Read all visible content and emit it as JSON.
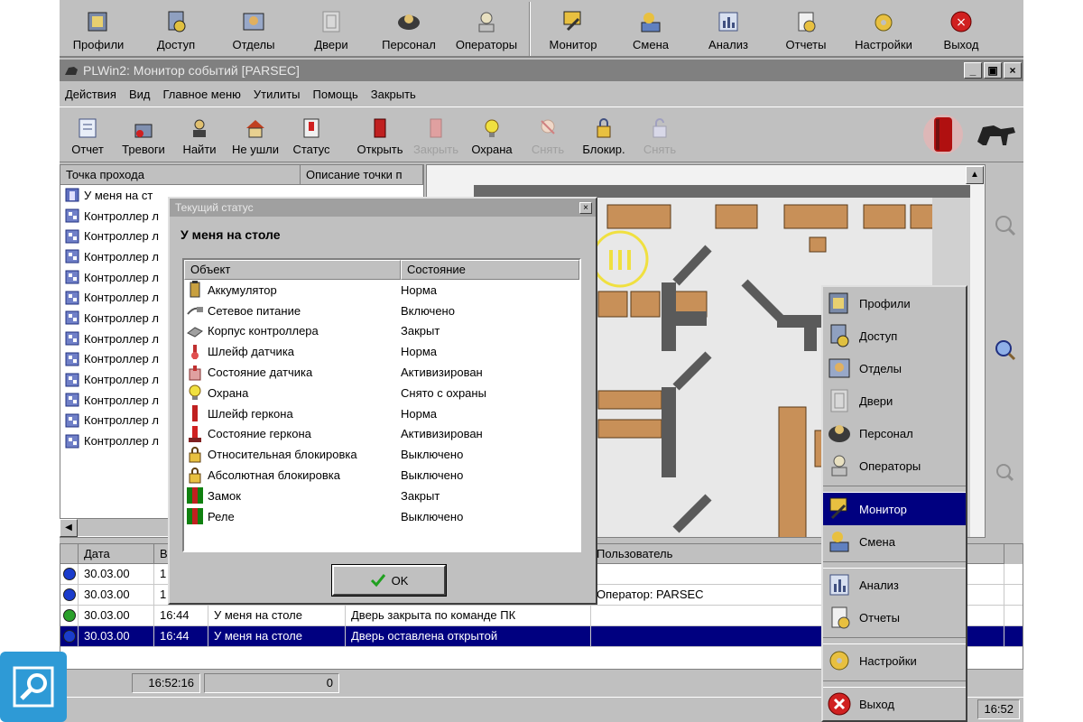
{
  "top_toolbar": [
    {
      "label": "Профили",
      "icon": "profiles-icon"
    },
    {
      "label": "Доступ",
      "icon": "access-icon"
    },
    {
      "label": "Отделы",
      "icon": "departments-icon"
    },
    {
      "label": "Двери",
      "icon": "doors-icon"
    },
    {
      "label": "Персонал",
      "icon": "personnel-icon"
    },
    {
      "label": "Операторы",
      "icon": "operators-icon"
    },
    {
      "label": "Монитор",
      "icon": "monitor-icon"
    },
    {
      "label": "Смена",
      "icon": "shift-icon"
    },
    {
      "label": "Анализ",
      "icon": "analysis-icon"
    },
    {
      "label": "Отчеты",
      "icon": "reports-icon"
    },
    {
      "label": "Настройки",
      "icon": "settings-icon"
    },
    {
      "label": "Выход",
      "icon": "exit-icon"
    }
  ],
  "window": {
    "title": "PLWin2: Монитор событий [PARSEC]",
    "controls": [
      "_",
      "▣",
      "×"
    ]
  },
  "menu": [
    "Действия",
    "Вид",
    "Главное меню",
    "Утилиты",
    "Помощь",
    "Закрыть"
  ],
  "toolbar2": [
    {
      "label": "Отчет",
      "disabled": false
    },
    {
      "label": "Тревоги",
      "disabled": false
    },
    {
      "label": "Найти",
      "disabled": false
    },
    {
      "label": "Не ушли",
      "disabled": false
    },
    {
      "label": "Статус",
      "disabled": false
    },
    {
      "label": "Открыть",
      "disabled": false
    },
    {
      "label": "Закрыть",
      "disabled": true
    },
    {
      "label": "Охрана",
      "disabled": false
    },
    {
      "label": "Снять",
      "disabled": true
    },
    {
      "label": "Блокир.",
      "disabled": false
    },
    {
      "label": "Снять",
      "disabled": true
    }
  ],
  "tree": {
    "columns": [
      "Точка прохода",
      "Описание точки п"
    ],
    "rows": [
      "У меня на ст",
      "Контроллер л",
      "Контроллер л",
      "Контроллер л",
      "Контроллер л",
      "Контроллер л",
      "Контроллер л",
      "Контроллер л",
      "Контроллер л",
      "Контроллер л",
      "Контроллер л",
      "Контроллер л",
      "Контроллер л"
    ]
  },
  "events": {
    "columns": [
      "",
      "Дата",
      "В",
      "",
      "",
      "Пользователь"
    ],
    "rows": [
      {
        "status": "#1a3ccc",
        "date": "30.03.00",
        "time": "1",
        "point": "",
        "event": "",
        "user": "",
        "selected": false
      },
      {
        "status": "#1a3ccc",
        "date": "30.03.00",
        "time": "1",
        "point": "",
        "event": "",
        "user": "Оператор: PARSEC",
        "selected": false
      },
      {
        "status": "#2aa02a",
        "date": "30.03.00",
        "time": "16:44",
        "point": "У меня на столе",
        "event": "Дверь закрыта по команде ПК",
        "user": "",
        "selected": false
      },
      {
        "status": "#1a3ccc",
        "date": "30.03.00",
        "time": "16:44",
        "point": "У меня на столе",
        "event": "Дверь оставлена открытой",
        "user": "",
        "selected": true
      }
    ]
  },
  "statusbar": {
    "time": "16:52:16",
    "count": "0",
    "clock": "16:52"
  },
  "dialog": {
    "title": "Текущий статус",
    "subtitle": "У меня на столе",
    "columns": [
      "Объект",
      "Состояние"
    ],
    "rows": [
      {
        "object": "Аккумулятор",
        "state": "Норма",
        "icon": "battery-icon"
      },
      {
        "object": "Сетевое питание",
        "state": "Включено",
        "icon": "power-plug-icon"
      },
      {
        "object": "Корпус контроллера",
        "state": "Закрыт",
        "icon": "controller-case-icon"
      },
      {
        "object": "Шлейф датчика",
        "state": "Норма",
        "icon": "sensor-loop-icon"
      },
      {
        "object": "Состояние датчика",
        "state": "Активизирован",
        "icon": "sensor-state-icon"
      },
      {
        "object": "Охрана",
        "state": "Снято с охраны",
        "icon": "guard-bulb-icon"
      },
      {
        "object": "Шлейф геркона",
        "state": "Норма",
        "icon": "reed-loop-icon"
      },
      {
        "object": "Состояние геркона",
        "state": "Активизирован",
        "icon": "reed-state-icon"
      },
      {
        "object": "Относительная блокировка",
        "state": "Выключено",
        "icon": "relative-lock-icon"
      },
      {
        "object": "Абсолютная блокировка",
        "state": "Выключено",
        "icon": "absolute-lock-icon"
      },
      {
        "object": "Замок",
        "state": "Закрыт",
        "icon": "door-lock-icon"
      },
      {
        "object": "Реле",
        "state": "Выключено",
        "icon": "relay-icon"
      }
    ],
    "ok_label": "OK"
  },
  "popup_menu": [
    {
      "label": "Профили",
      "icon": "profiles-icon",
      "selected": false
    },
    {
      "label": "Доступ",
      "icon": "access-icon",
      "selected": false
    },
    {
      "label": "Отделы",
      "icon": "departments-icon",
      "selected": false
    },
    {
      "label": "Двери",
      "icon": "doors-icon",
      "selected": false
    },
    {
      "label": "Персонал",
      "icon": "personnel-icon",
      "selected": false
    },
    {
      "label": "Операторы",
      "icon": "operators-icon",
      "selected": false
    },
    {
      "label": "Монитор",
      "icon": "monitor-icon",
      "selected": true
    },
    {
      "label": "Смена",
      "icon": "shift-icon",
      "selected": false
    },
    {
      "label": "Анализ",
      "icon": "analysis-icon",
      "selected": false
    },
    {
      "label": "Отчеты",
      "icon": "reports-icon",
      "selected": false
    },
    {
      "label": "Настройки",
      "icon": "settings-icon",
      "selected": false
    },
    {
      "label": "Выход",
      "icon": "exit-icon",
      "selected": false
    }
  ],
  "colors": {
    "selection": "#000080",
    "face": "#c0c0c0",
    "title_inactive": "#808080"
  }
}
